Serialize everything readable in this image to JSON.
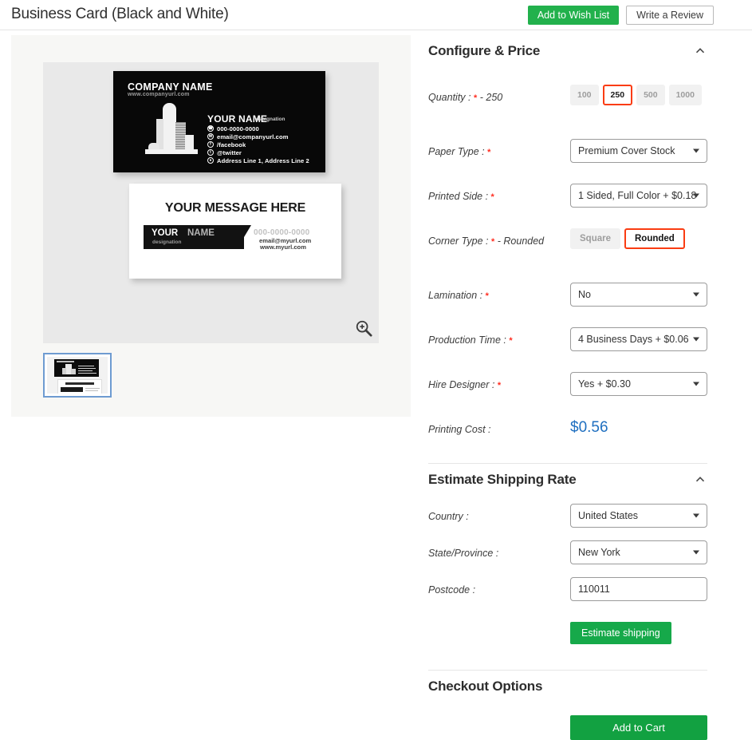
{
  "header": {
    "product_title": "Business Card (Black and White)",
    "wishlist_label": "Add to Wish List",
    "review_label": "Write a Review"
  },
  "gallery": {
    "zoom_icon": "zoom-in-magnifier-icon",
    "thumbnail_alt": "business-card-thumbnail",
    "card_black": {
      "company": "COMPANY NAME",
      "website": "www.companyurl.com",
      "name": "YOUR NAME",
      "designation": "designation",
      "contacts": [
        {
          "icon": "phone-icon",
          "glyph": "✆",
          "text": "000-0000-0000"
        },
        {
          "icon": "email-icon",
          "glyph": "✉",
          "text": "email@companyurl.com"
        },
        {
          "icon": "facebook-icon",
          "glyph": "f",
          "text": "/facebook"
        },
        {
          "icon": "twitter-icon",
          "glyph": "t",
          "text": "@twitter"
        },
        {
          "icon": "location-icon",
          "glyph": "●",
          "text": "Address Line 1, Address Line 2"
        }
      ]
    },
    "card_white": {
      "message": "YOUR MESSAGE HERE",
      "name_first": "YOUR",
      "name_last": "NAME",
      "designation": "designation",
      "phone": "000-0000-0000",
      "email": "email@myurl.com",
      "website": "www.myurl.com"
    }
  },
  "configure": {
    "title": "Configure & Price",
    "collapse_icon": "chevron-up-icon",
    "quantity": {
      "label": "Quantity :",
      "required": "*",
      "selected_suffix": "- 250",
      "options": [
        "100",
        "250",
        "500",
        "1000"
      ],
      "selected": "250"
    },
    "paper_type": {
      "label": "Paper Type :",
      "required": "*",
      "value": "Premium Cover Stock"
    },
    "printed_side": {
      "label": "Printed Side :",
      "required": "*",
      "value": "1 Sided, Full Color + $0.18"
    },
    "corner_type": {
      "label": "Corner Type :",
      "required": "*",
      "selected_suffix": "- Rounded",
      "options": [
        "Square",
        "Rounded"
      ],
      "selected": "Rounded"
    },
    "lamination": {
      "label": "Lamination :",
      "required": "*",
      "value": "No"
    },
    "production_time": {
      "label": "Production Time :",
      "required": "*",
      "value": "4 Business Days + $0.06"
    },
    "hire_designer": {
      "label": "Hire Designer :",
      "required": "*",
      "value": "Yes + $0.30"
    },
    "printing_cost": {
      "label": "Printing Cost :",
      "value": "$0.56"
    }
  },
  "shipping": {
    "title": "Estimate Shipping Rate",
    "collapse_icon": "chevron-up-icon",
    "country": {
      "label": "Country :",
      "value": "United States"
    },
    "state": {
      "label": "State/Province :",
      "value": "New York"
    },
    "postcode": {
      "label": "Postcode :",
      "value": "110011",
      "placeholder": ""
    },
    "estimate_button": "Estimate shipping"
  },
  "checkout": {
    "title": "Checkout Options",
    "add_to_cart": "Add to Cart"
  },
  "colors": {
    "green_primary": "#22b14c",
    "green_cart": "#12a141",
    "green_estimate": "#16a94a",
    "accent_selected": "#fa3c12",
    "price_blue": "#1f6fc0",
    "required_red": "#ff2d20"
  }
}
